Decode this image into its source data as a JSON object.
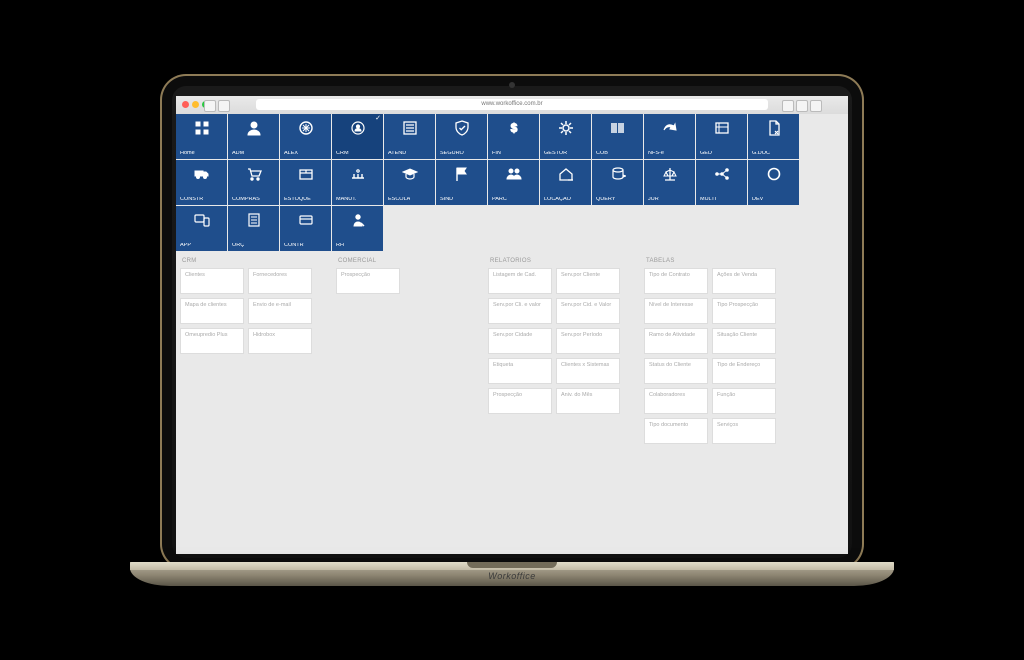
{
  "laptop_brand": "Workoffice",
  "browser": {
    "url": "www.workoffice.com.br"
  },
  "colors": {
    "tile_bg": "#1F4E8C",
    "tile_active_bg": "#16427c",
    "page_bg": "#e9e9e9"
  },
  "tiles": [
    {
      "label": "Home",
      "icon": "grid"
    },
    {
      "label": "ADM",
      "icon": "user"
    },
    {
      "label": "ALEX",
      "icon": "brain"
    },
    {
      "label": "CRM",
      "icon": "crm",
      "active": true
    },
    {
      "label": "ATEND",
      "icon": "list"
    },
    {
      "label": "SEGURO",
      "icon": "shield"
    },
    {
      "label": "FIN",
      "icon": "dollar"
    },
    {
      "label": "GESTOR",
      "icon": "gear"
    },
    {
      "label": "COB",
      "icon": "barcode"
    },
    {
      "label": "NFS-e",
      "icon": "nfs"
    },
    {
      "label": "GED",
      "icon": "folder"
    },
    {
      "label": "G.DOC",
      "icon": "doc"
    },
    {
      "label": "CONSTR",
      "icon": "truck"
    },
    {
      "label": "COMPRAS",
      "icon": "cart"
    },
    {
      "label": "ESTOQUE",
      "icon": "box"
    },
    {
      "label": "MANUT.",
      "icon": "wrench"
    },
    {
      "label": "ESCOLA",
      "icon": "grad"
    },
    {
      "label": "SIND",
      "icon": "flag"
    },
    {
      "label": "PARC",
      "icon": "people"
    },
    {
      "label": "LOCAÇÃO",
      "icon": "house"
    },
    {
      "label": "QUERY",
      "icon": "db"
    },
    {
      "label": "JUR",
      "icon": "scale"
    },
    {
      "label": "MULTI",
      "icon": "net"
    },
    {
      "label": "DEV",
      "icon": "circle"
    },
    {
      "label": "APP",
      "icon": "devices"
    },
    {
      "label": "ORÇ",
      "icon": "sheet"
    },
    {
      "label": "CONTR",
      "icon": "card"
    },
    {
      "label": "RH",
      "icon": "rh"
    }
  ],
  "sections": [
    {
      "title": "CRM",
      "width": "crm",
      "cards": [
        "Clientes",
        "Fornecedores",
        "Mapa de clientes",
        "Envio de e-mail",
        "Omeupredio Plus",
        "Hidrobox"
      ]
    },
    {
      "title": "COMERCIAL",
      "width": "com",
      "cards": [
        "Prospecção"
      ]
    },
    {
      "title": "",
      "width": "gap",
      "cards": []
    },
    {
      "title": "RELATORIOS",
      "width": "rel",
      "cards": [
        "Listagem de Cad.",
        "Serv.por Cliente",
        "Serv.por Cli. e valor",
        "Serv.por Cid. e Valor",
        "Serv.por Cidade",
        "Serv.por Período",
        "Etiqueta",
        "Clientes x Sistemas",
        "Prospecção",
        "Aniv. do Mês"
      ]
    },
    {
      "title": "TABELAS",
      "width": "tab",
      "cards": [
        "Tipo de Contrato",
        "Ações de Venda",
        "Nível de Interesse",
        "Tipo Prospecção",
        "Ramo de Atividade",
        "Situação Cliente",
        "Status do Cliente",
        "Tipo de Endereço",
        "Colaboradores",
        "Função",
        "Tipo documento",
        "Serviços"
      ]
    }
  ]
}
